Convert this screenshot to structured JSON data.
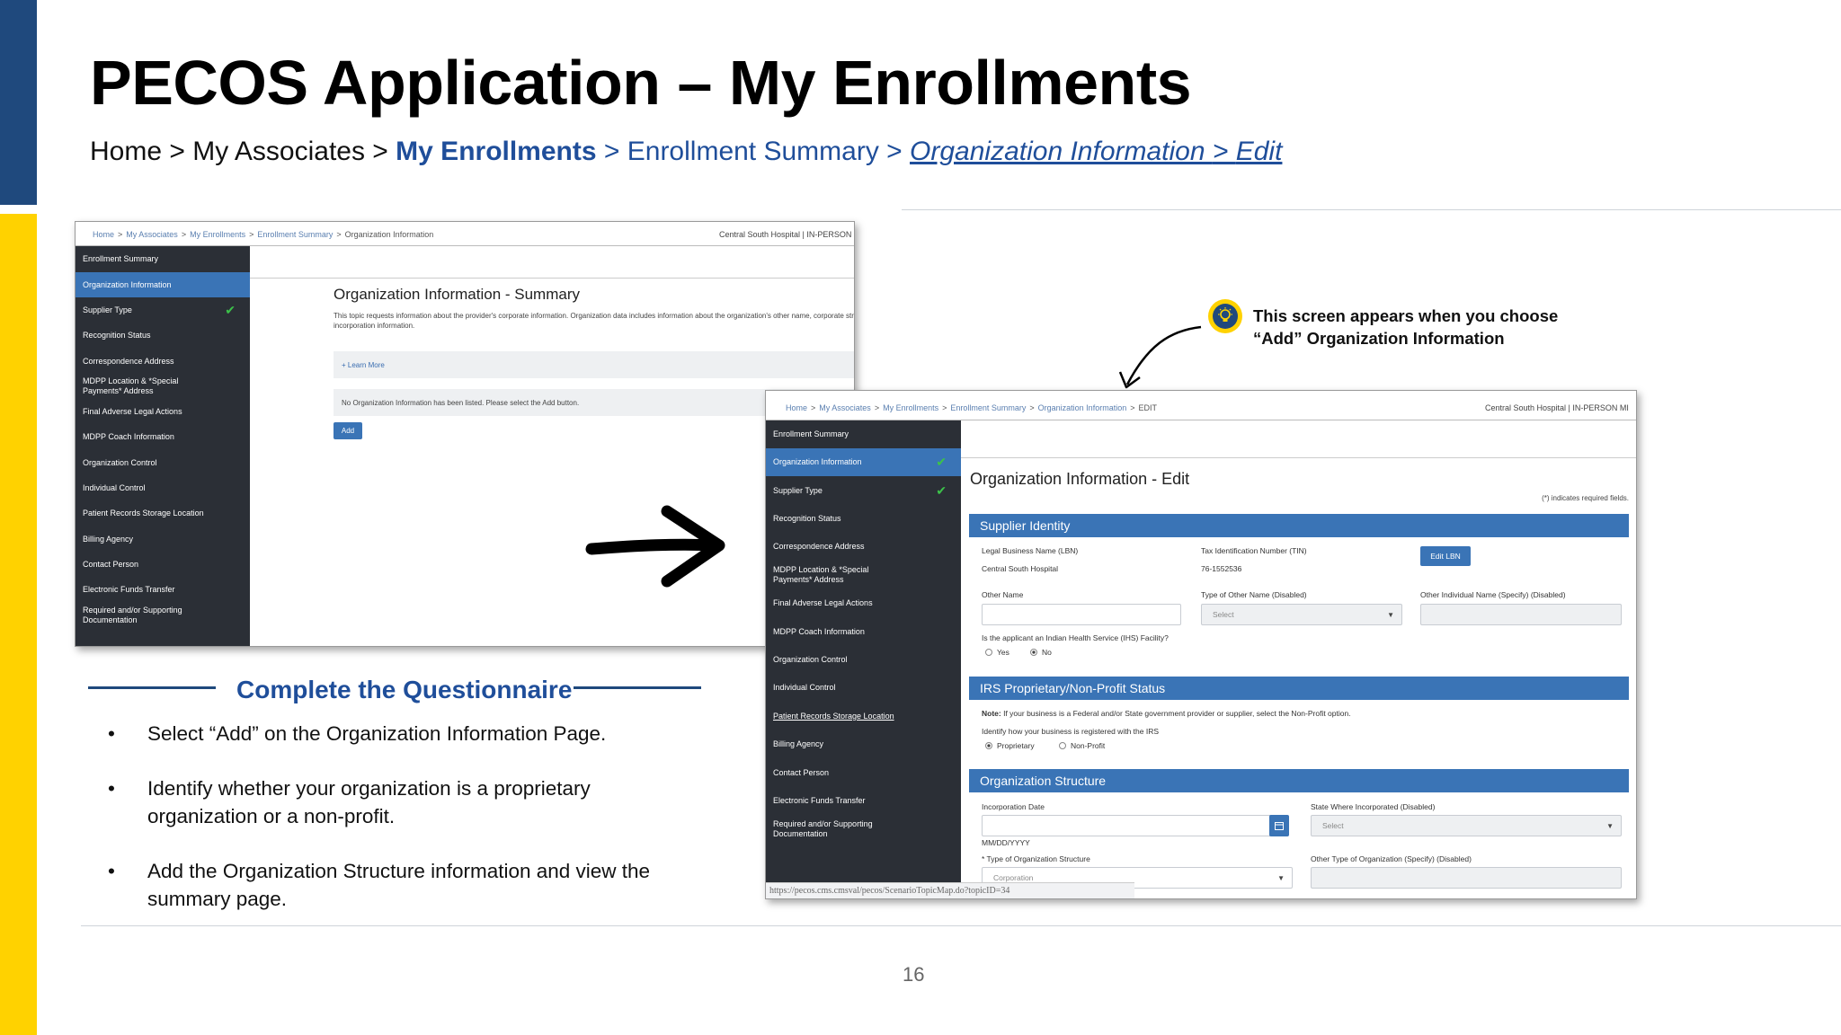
{
  "slide": {
    "title": "PECOS Application – My Enrollments",
    "breadcrumb": {
      "home": "Home",
      "sep1": " > ",
      "associates": "My Associates",
      "sep2": " > ",
      "enrollments": "My Enrollments",
      "sep3": " > ",
      "summary": "Enrollment Summary",
      "sep4": " > ",
      "org_info": "Organization Information ",
      "sep5": "> ",
      "edit": "Edit"
    },
    "page_number": "16",
    "colors": {
      "navy": "#1f497d",
      "yellow": "#ffd200",
      "link_blue": "#1f4e9a",
      "panel_blue": "#3a74b6",
      "sidebar": "#2b2f36"
    }
  },
  "screenshot1": {
    "breadcrumb": [
      "Home",
      "My Associates",
      "My Enrollments",
      "Enrollment Summary",
      "Organization Information"
    ],
    "sep": ">",
    "top_right": "Central South Hospital |  IN-PERSON MI",
    "sidebar": [
      "Enrollment Summary",
      "Organization Information",
      "Supplier Type",
      "Recognition Status",
      "Correspondence Address",
      "MDPP Location & *Special Payments* Address",
      "Final Adverse Legal Actions",
      "MDPP Coach Information",
      "Organization Control",
      "Individual Control",
      "Patient Records Storage Location",
      "Billing Agency",
      "Contact Person",
      "Electronic Funds Transfer",
      "Required and/or Supporting Documentation"
    ],
    "title": "Organization Information - Summary",
    "description": "This topic requests information about the provider's corporate information. Organization data includes information about the organization's other name, corporate structure type, and incorporation information.",
    "learn_more": "+ Learn More",
    "no_info_msg": "No Organization Information has been listed. Please select the Add button.",
    "add_label": "Add"
  },
  "callout": {
    "line1": "This screen appears when you choose",
    "line2": "“Add” Organization Information",
    "icon": "lightbulb-icon"
  },
  "screenshot2": {
    "breadcrumb": [
      "Home",
      "My Associates",
      "My Enrollments",
      "Enrollment Summary",
      "Organization Information"
    ],
    "current": "EDIT",
    "sep": ">",
    "top_right": "Central South Hospital |  IN-PERSON MI",
    "sidebar": [
      "Enrollment Summary",
      "Organization Information",
      "Supplier Type",
      "Recognition Status",
      "Correspondence Address",
      "MDPP Location & *Special Payments* Address",
      "Final Adverse Legal Actions",
      "MDPP Coach Information",
      "Organization Control",
      "Individual Control",
      "Patient Records Storage Location",
      "Billing Agency",
      "Contact Person",
      "Electronic Funds Transfer",
      "Required and/or Supporting Documentation"
    ],
    "title": "Organization Information - Edit",
    "required_note": "(*) indicates required fields.",
    "supplier_identity": {
      "header": "Supplier Identity",
      "lbn_label": "Legal Business Name (LBN)",
      "lbn_value": "Central South Hospital",
      "tin_label": "Tax Identification Number (TIN)",
      "tin_value": "76-1552536",
      "edit_lbn": "Edit LBN",
      "other_name_label": "Other Name",
      "type_other_label": "Type of Other Name (Disabled)",
      "type_other_value": "Select",
      "other_individual_label": "Other Individual Name (Specify) (Disabled)",
      "ihs_question": "Is the applicant an Indian Health Service (IHS) Facility?",
      "yes": "Yes",
      "no": "No"
    },
    "irs": {
      "header": "IRS Proprietary/Non-Profit Status",
      "note_bold": "Note:",
      "note": " If your business is a Federal and/or State government provider or supplier, select the Non-Profit option.",
      "identify": "Identify how your business is registered with the IRS",
      "proprietary": "Proprietary",
      "nonprofit": "Non-Profit"
    },
    "structure": {
      "header": "Organization Structure",
      "incorporation_label": "Incorporation Date",
      "date_format": "MM/DD/YYYY",
      "state_label": "State Where Incorporated (Disabled)",
      "state_value": "Select",
      "type_label": "* Type of Organization Structure",
      "type_value": "Corporation",
      "other_type_label": "Other Type of Organization (Specify) (Disabled)"
    },
    "status_url": "https://pecos.cms.cmsval/pecos/ScenarioTopicMap.do?topicID=34"
  },
  "questionnaire": {
    "title": "Complete the Questionnaire",
    "bullets": [
      "Select “Add” on the Organization Information Page.",
      "Identify whether your organization is a proprietary organization or a non-profit.",
      "Add the Organization Structure information and view the summary page."
    ],
    "bullet_char": "•"
  }
}
